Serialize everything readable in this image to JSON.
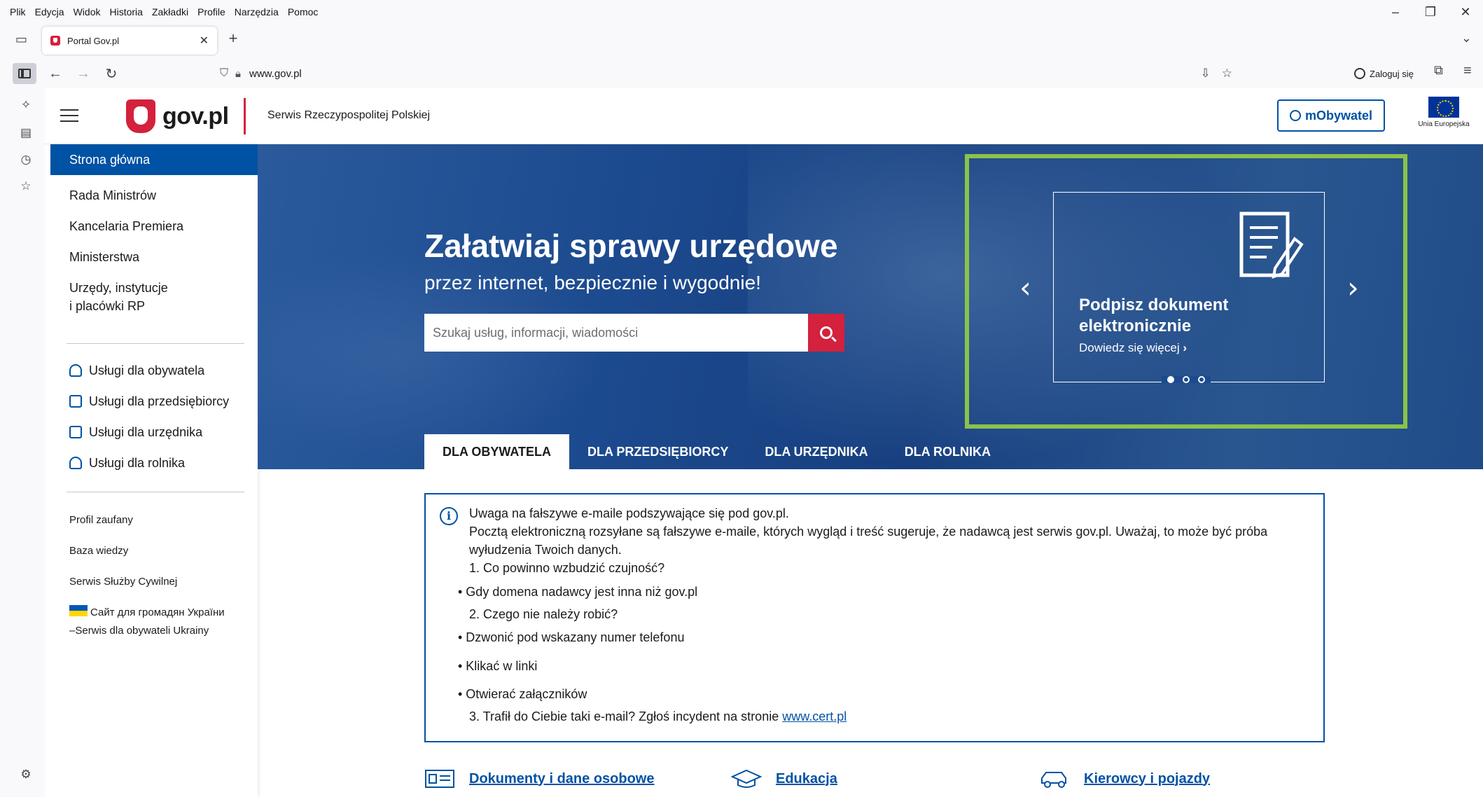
{
  "browser": {
    "menu": [
      "Plik",
      "Edycja",
      "Widok",
      "Historia",
      "Zakładki",
      "Profile",
      "Narzędzia",
      "Pomoc"
    ],
    "window_controls": {
      "minimize": "–",
      "restore": "❐",
      "close": "✕"
    },
    "tab": {
      "title": "Portal Gov.pl",
      "close": "✕"
    },
    "new_tab": "+",
    "url": "www.gov.pl",
    "login_label": "Zaloguj się"
  },
  "header": {
    "logo_text": "gov.pl",
    "tagline": "Serwis Rzeczypospolitej Polskiej",
    "mobywatel_label": "mObywatel",
    "eu_label": "Unia Europejska"
  },
  "nav": {
    "main": [
      "Strona główna",
      "Rada Ministrów",
      "Kancelaria Premiera",
      "Ministerstwa",
      "Urzędy, instytucje",
      "i placówki RP"
    ],
    "services": [
      "Usługi dla obywatela",
      "Usługi dla przedsiębiorcy",
      "Usługi dla urzędnika",
      "Usługi dla rolnika"
    ],
    "links": [
      "Profil zaufany",
      "Baza wiedzy",
      "Serwis Służby Cywilnej"
    ],
    "ukraine": {
      "line1": "Сайт для громадян України",
      "line2": "–Serwis dla obywateli Ukrainy"
    }
  },
  "hero": {
    "title": "Załatwiaj sprawy urzędowe",
    "subtitle": "przez internet, bezpiecznie i wygodnie!",
    "search_placeholder": "Szukaj usług, informacji, wiadomości",
    "slide": {
      "title": "Podpisz dokument elektronicznie",
      "link": "Dowiedz się więcej",
      "link_arrow": "›",
      "active_index": 0,
      "count": 3
    },
    "arrow_prev": "‹",
    "arrow_next": "›",
    "tabs": [
      "DLA OBYWATELA",
      "DLA PRZEDSIĘBIORCY",
      "DLA URZĘDNIKA",
      "DLA ROLNIKA"
    ]
  },
  "alert": {
    "icon": "i",
    "title": "Uwaga na fałszywe e-maile podszywające się pod gov.pl.",
    "text1": "Pocztą elektroniczną rozsyłane są fałszywe e-maile, których wygląd i treść sugeruje, że nadawcą jest serwis gov.pl. Uważaj, to może być próba",
    "text2": "wyłudzenia Twoich danych.",
    "q1": "1. Co powinno wzbudzić czujność?",
    "b1": "•  Gdy domena nadawcy jest inna niż gov.pl",
    "q2": "2. Czego nie należy robić?",
    "b2": "• Dzwonić pod wskazany numer telefonu",
    "b3": "• Klikać w linki",
    "b4": "• Otwierać załączników",
    "q3": "3. Trafił do Ciebie taki e-mail? Zgłoś incydent na stronie ",
    "q3_link": "www.cert.pl"
  },
  "categories": [
    "Dokumenty i dane osobowe",
    "Edukacja",
    "Kierowcy i pojazdy"
  ],
  "colors": {
    "brand_blue": "#0052a5",
    "brand_red": "#d4213d",
    "highlight_green": "#8bc34a"
  }
}
